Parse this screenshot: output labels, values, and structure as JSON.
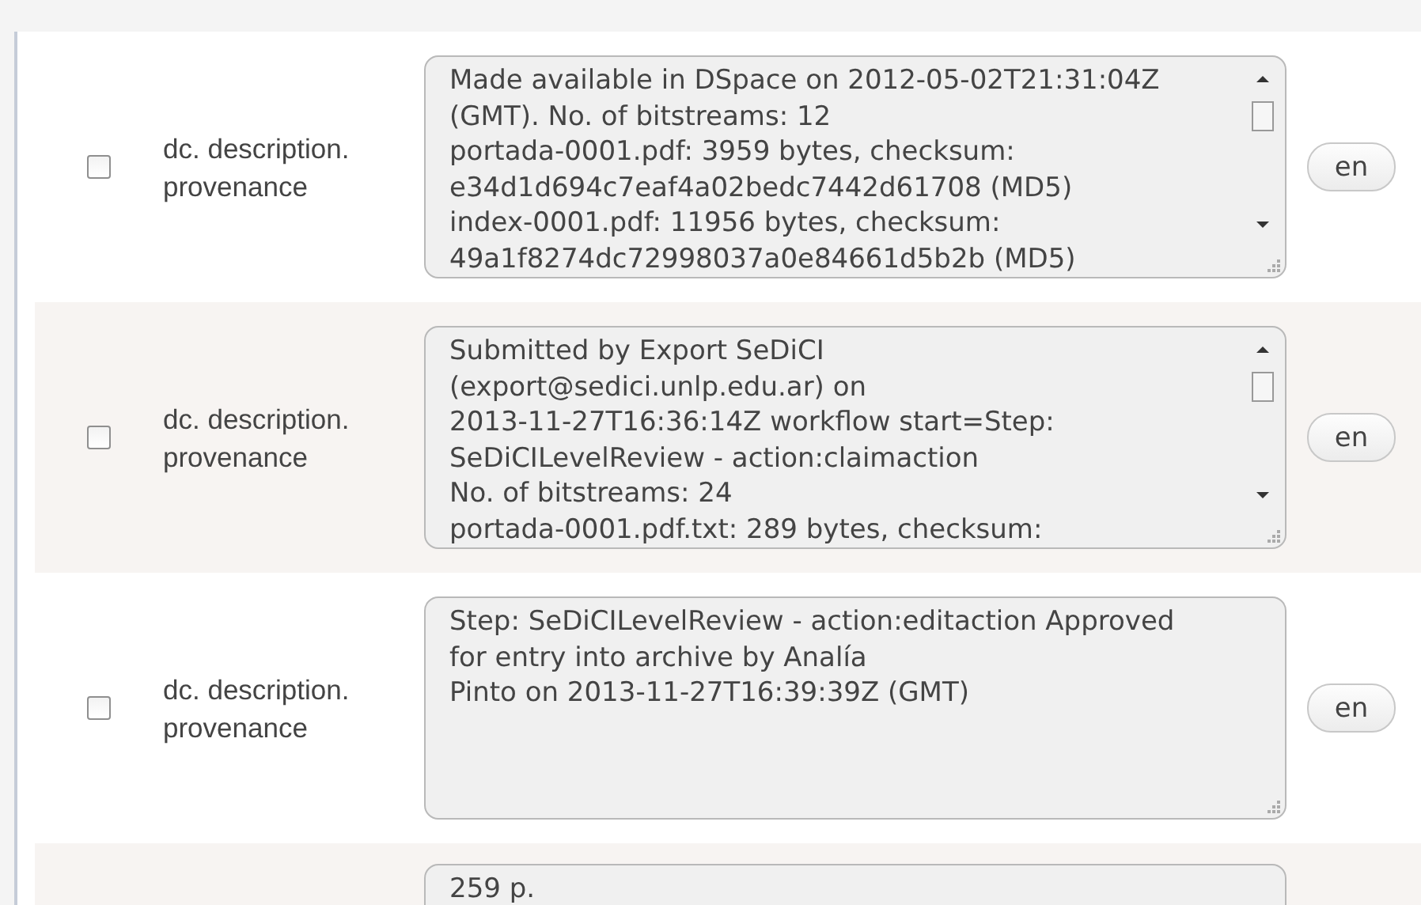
{
  "rows": [
    {
      "checked": false,
      "field": "dc. description.\nprovenance",
      "value": "Made available in DSpace on 2012-05-02T21:31:04Z\n(GMT). No. of bitstreams: 12\nportada-0001.pdf: 3959 bytes, checksum:\ne34d1d694c7eaf4a02bedc7442d61708 (MD5)\nindex-0001.pdf: 11956 bytes, checksum:\n49a1f8274dc72998037a0e84661d5b2b (MD5)",
      "scrollable": true,
      "language": "en"
    },
    {
      "checked": false,
      "field": "dc. description.\nprovenance",
      "value": "Submitted by Export SeDiCI\n(export@sedici.unlp.edu.ar) on\n2013-11-27T16:36:14Z workflow start=Step:\nSeDiCILevelReview - action:claimaction\nNo. of bitstreams: 24\nportada-0001.pdf.txt: 289 bytes, checksum:",
      "scrollable": true,
      "language": "en"
    },
    {
      "checked": false,
      "field": "dc. description.\nprovenance",
      "value": "Step: SeDiCILevelReview - action:editaction Approved\nfor entry into archive by Analía\nPinto on 2013-11-27T16:39:39Z (GMT)",
      "scrollable": false,
      "language": "en"
    },
    {
      "value": "259 p.",
      "scrollable": false
    }
  ]
}
